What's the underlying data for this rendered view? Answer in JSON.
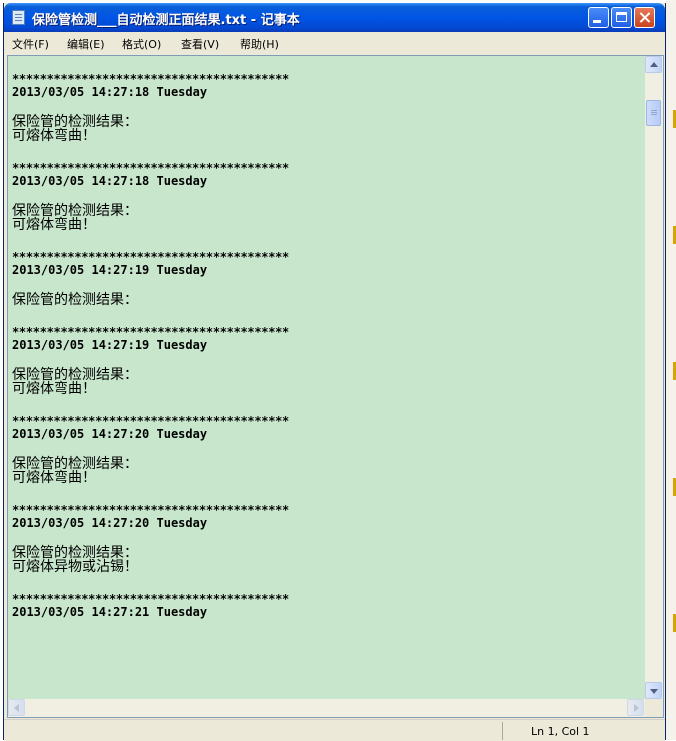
{
  "window": {
    "title": "保险管检测___自动检测正面结果.txt - 记事本"
  },
  "menu": [
    {
      "label": "文件(F)"
    },
    {
      "label": "编辑(E)"
    },
    {
      "label": "格式(O)"
    },
    {
      "label": "查看(V)"
    },
    {
      "label": "帮助(H)"
    }
  ],
  "document": {
    "separator": "****************************************",
    "entries": [
      {
        "datetime": "2013/03/05 14:27:18 Tuesday",
        "heading": "保险管的检测结果：",
        "detail": "可熔体弯曲！"
      },
      {
        "datetime": "2013/03/05 14:27:18 Tuesday",
        "heading": "保险管的检测结果：",
        "detail": "可熔体弯曲！"
      },
      {
        "datetime": "2013/03/05 14:27:19 Tuesday",
        "heading": "保险管的检测结果：",
        "detail": ""
      },
      {
        "datetime": "2013/03/05 14:27:19 Tuesday",
        "heading": "保险管的检测结果：",
        "detail": "可熔体弯曲！"
      },
      {
        "datetime": "2013/03/05 14:27:20 Tuesday",
        "heading": "保险管的检测结果：",
        "detail": "可熔体弯曲！"
      },
      {
        "datetime": "2013/03/05 14:27:20 Tuesday",
        "heading": "保险管的检测结果：",
        "detail": "可熔体异物或沾锡！"
      },
      {
        "datetime": "2013/03/05 14:27:21 Tuesday",
        "heading": "",
        "detail": ""
      }
    ]
  },
  "status": {
    "position": "Ln 1, Col 1"
  },
  "colors": {
    "editor_background": "#c8e6cc",
    "titlebar": "#0055e5"
  },
  "icons": {
    "app": "notepad-icon",
    "minimize": "minimize-icon",
    "maximize": "maximize-icon",
    "close": "close-icon"
  }
}
